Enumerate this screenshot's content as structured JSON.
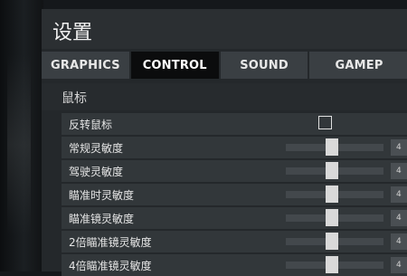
{
  "window": {
    "title": "设置"
  },
  "tabs": [
    {
      "label": "GRAPHICS"
    },
    {
      "label": "CONTROL"
    },
    {
      "label": "SOUND"
    },
    {
      "label": "GAMEP"
    }
  ],
  "active_tab": "CONTROL",
  "section": {
    "title": "鼠标"
  },
  "rows": [
    {
      "label": "反转鼠标",
      "type": "checkbox",
      "checked": false
    },
    {
      "label": "常规灵敏度",
      "type": "slider",
      "slider_level": 0.47,
      "value_text": "4"
    },
    {
      "label": "驾驶灵敏度",
      "type": "slider",
      "slider_level": 0.47,
      "value_text": "4"
    },
    {
      "label": "瞄准时灵敏度",
      "type": "slider",
      "slider_level": 0.47,
      "value_text": "4"
    },
    {
      "label": "瞄准镜灵敏度",
      "type": "slider",
      "slider_level": 0.47,
      "value_text": "4"
    },
    {
      "label": "2倍瞄准镜灵敏度",
      "type": "slider",
      "slider_level": 0.47,
      "value_text": "4"
    },
    {
      "label": "4倍瞄准镜灵敏度",
      "type": "slider",
      "slider_level": 0.47,
      "value_text": "4"
    }
  ],
  "colors": {
    "active_tab": "#0b0c0d",
    "inactive_tab": "#3a3f43",
    "row": "#32373a",
    "slider_thumb": "#d9d9d9"
  }
}
